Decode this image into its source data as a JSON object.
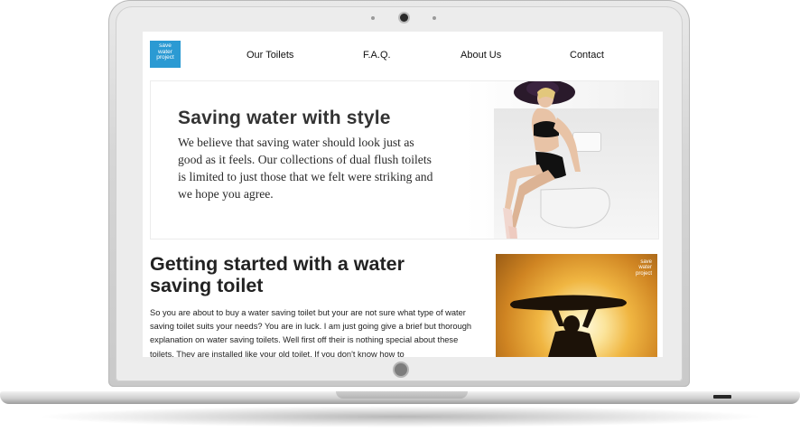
{
  "site": {
    "logo_lines": [
      "save",
      "water",
      "project"
    ]
  },
  "nav": [
    {
      "label": "Our Toilets"
    },
    {
      "label": "F.A.Q."
    },
    {
      "label": "About Us"
    },
    {
      "label": "Contact"
    }
  ],
  "hero": {
    "title": "Saving water with style",
    "text": "We believe that saving water should look just as good as it feels. Our collections of dual flush toilets is limited to just those that we felt were striking and we hope you agree."
  },
  "article": {
    "title": "Getting started with a water saving toilet",
    "body": "So you are about to buy a water saving toilet but your are not sure what type of water saving toilet suits your needs? You are in luck. I am just going give a brief but thorough explanation on water saving toilets. Well first off their is nothing special about these toilets. They are installed like your old toilet. If you don't know how to"
  },
  "side_image": {
    "logo_lines": [
      "save",
      "water",
      "project"
    ]
  },
  "colors": {
    "brand_blue": "#2b9ad3",
    "sunset": "#f0b642"
  },
  "icons": {
    "camera": "camera-icon",
    "home": "home-button-icon"
  }
}
